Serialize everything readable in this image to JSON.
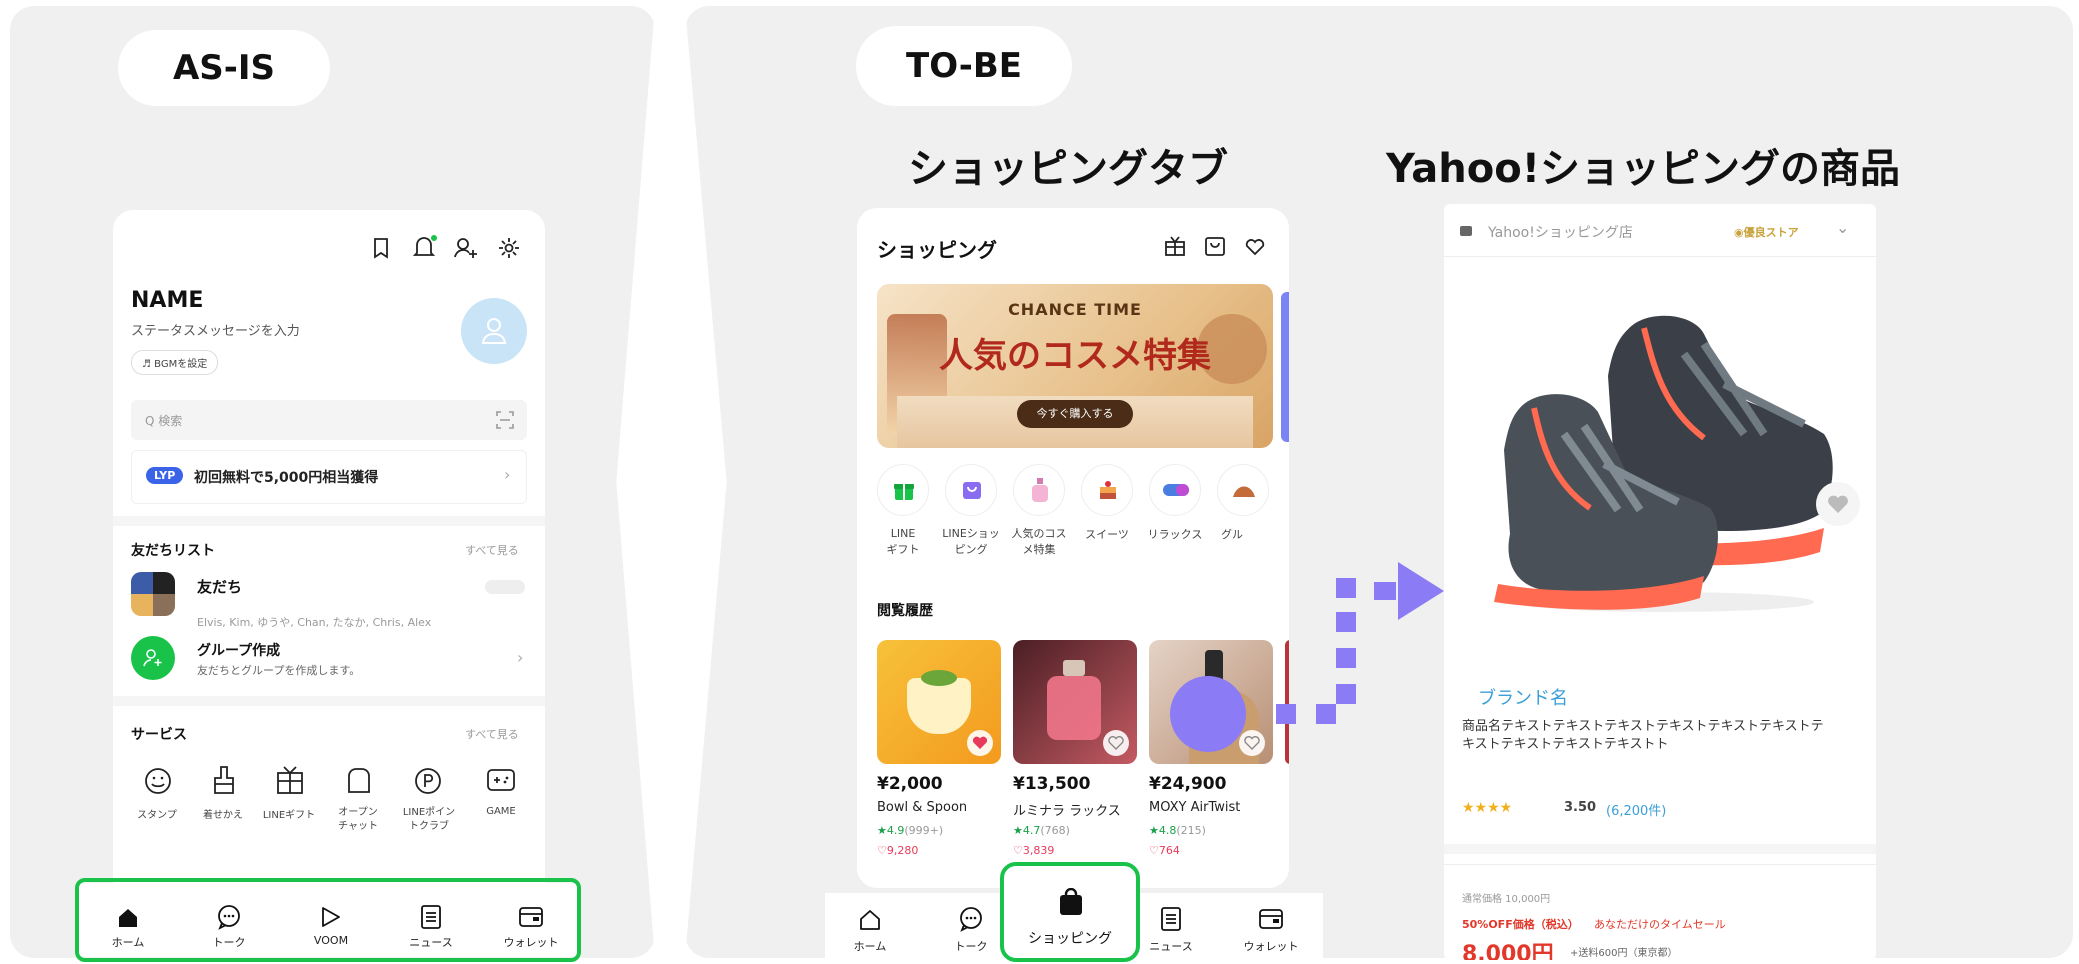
{
  "as_is": {
    "badge": "AS-IS",
    "profile": {
      "name": "NAME",
      "status_placeholder": "ステータスメッセージを入力",
      "bgm_label": "♬ BGMを設定"
    },
    "search": {
      "placeholder": "Q 検索"
    },
    "banner": {
      "badge": "LYP",
      "text": "初回無料で5,000円相当獲得"
    },
    "friends": {
      "title": "友だちリスト",
      "see_all": "すべて見る",
      "friend_label": "友だち",
      "friend_names": "Elvis, Kim, ゆうや, Chan, たなか, Chris, Alex",
      "group_title": "グループ作成",
      "group_sub": "友だちとグループを作成します。"
    },
    "services": {
      "title": "サービス",
      "see_all": "すべて見る",
      "items": [
        {
          "label": "スタンプ",
          "icon": "smile-icon"
        },
        {
          "label": "着せかえ",
          "icon": "brush-icon"
        },
        {
          "label": "LINEギフト",
          "icon": "gift-icon"
        },
        {
          "label": "オープン\nチャット",
          "icon": "chat-bubble-icon"
        },
        {
          "label": "LINEポイン\nトクラブ",
          "icon": "point-icon"
        },
        {
          "label": "GAME",
          "icon": "gamepad-icon"
        }
      ]
    },
    "nav": [
      {
        "label": "ホーム",
        "icon": "home-icon"
      },
      {
        "label": "トーク",
        "icon": "talk-icon"
      },
      {
        "label": "VOOM",
        "icon": "voom-icon"
      },
      {
        "label": "ニュース",
        "icon": "news-icon"
      },
      {
        "label": "ウォレット",
        "icon": "wallet-icon"
      }
    ]
  },
  "to_be": {
    "badge": "TO-BE",
    "heading_shopping": "ショッピングタブ",
    "heading_yahoo": "Yahoo!ショッピングの商品",
    "shopping": {
      "title": "ショッピング",
      "banner_top": "CHANCE TIME",
      "banner_main": "人気のコスメ特集",
      "banner_button": "今すぐ購入する",
      "categories": [
        {
          "label": "LINE\nギフト",
          "icon": "gift-icon"
        },
        {
          "label": "LINEショッ\nピング",
          "icon": "shopping-bag-icon"
        },
        {
          "label": "人気のコス\nメ特集",
          "icon": "perfume-icon"
        },
        {
          "label": "スイーツ",
          "icon": "cake-icon"
        },
        {
          "label": "リラックス",
          "icon": "pill-icon"
        },
        {
          "label": "グル",
          "icon": "food-icon"
        }
      ],
      "history_title": "閲覧履歴",
      "products": [
        {
          "price": "¥2,000",
          "name": "Bowl & Spoon",
          "rating": "★4.9",
          "reviews": "(999+)",
          "likes": "♡9,280",
          "liked": true
        },
        {
          "price": "¥13,500",
          "name": "ルミナラ ラックス",
          "rating": "★4.7",
          "reviews": "(768)",
          "likes": "♡3,839",
          "liked": false
        },
        {
          "price": "¥24,900",
          "name": "MOXY AirTwist",
          "rating": "★4.8",
          "reviews": "(215)",
          "likes": "♡764",
          "liked": false
        }
      ],
      "nav": [
        {
          "label": "ホーム",
          "icon": "home-icon"
        },
        {
          "label": "トーク",
          "icon": "talk-icon"
        },
        {
          "label": "ショッピング",
          "icon": "shopping-bag-icon"
        },
        {
          "label": "ニュース",
          "icon": "news-icon"
        },
        {
          "label": "ウォレット",
          "icon": "wallet-icon"
        }
      ]
    },
    "yahoo": {
      "store": "Yahoo!ショッピング店",
      "store_badge": "◉優良ストア",
      "brand": "ブランド名",
      "product_name": "商品名テキストテキストテキストテキストテキストテキストテキストテキストテキストテキストト",
      "stars": "★★★★",
      "rating": "3.50",
      "reviews": "(6,200件)",
      "regular_price": "通常価格 10,000円",
      "sale_label": "50%OFF価格（税込）",
      "sale_note": "あなただけのタイムセール",
      "price": "8,000円",
      "shipping": "+送料600円（東京都）"
    },
    "colors": {
      "accent_green": "#19c34a",
      "flow_purple": "#8b7cf6",
      "line_green": "#06c755"
    }
  }
}
